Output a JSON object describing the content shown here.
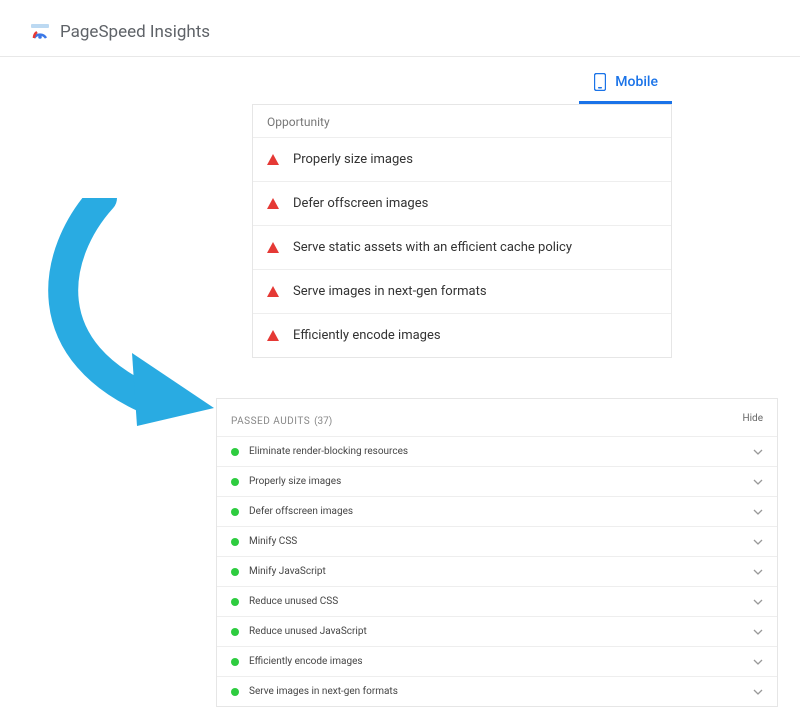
{
  "header": {
    "title": "PageSpeed Insights"
  },
  "tabs": {
    "mobile": "Mobile"
  },
  "opportunity": {
    "header": "Opportunity",
    "items": [
      {
        "label": "Properly size images"
      },
      {
        "label": "Defer offscreen images"
      },
      {
        "label": "Serve static assets with an efficient cache policy"
      },
      {
        "label": "Serve images in next-gen formats"
      },
      {
        "label": "Efficiently encode images"
      }
    ]
  },
  "passed": {
    "title": "PASSED AUDITS",
    "count": "(37)",
    "hide": "Hide",
    "items": [
      {
        "label": "Eliminate render-blocking resources"
      },
      {
        "label": "Properly size images"
      },
      {
        "label": "Defer offscreen images"
      },
      {
        "label": "Minify CSS"
      },
      {
        "label": "Minify JavaScript"
      },
      {
        "label": "Reduce unused CSS"
      },
      {
        "label": "Reduce unused JavaScript"
      },
      {
        "label": "Efficiently encode images"
      },
      {
        "label": "Serve images in next-gen formats"
      }
    ]
  }
}
